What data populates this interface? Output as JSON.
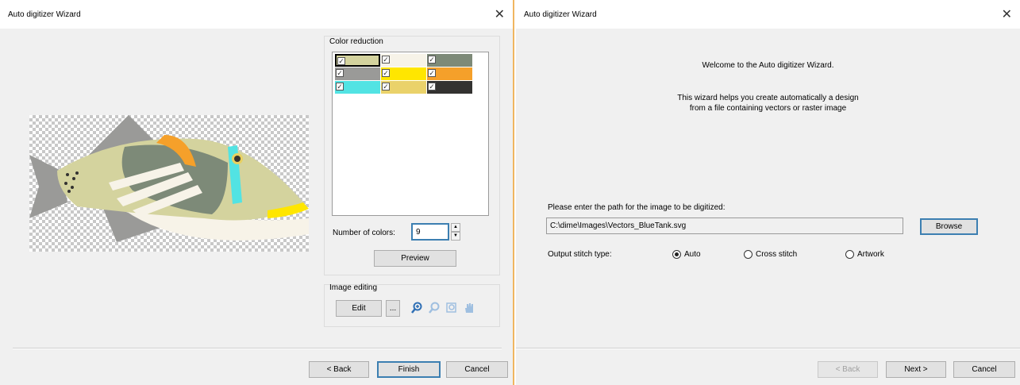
{
  "left_dialog": {
    "title": "Auto digitizer Wizard",
    "close_glyph": "✕",
    "color_reduction": {
      "label": "Color reduction",
      "swatches": [
        {
          "color": "#d4d39e",
          "checked": true,
          "selected": true
        },
        {
          "color": "#f7f3e8",
          "checked": true
        },
        {
          "color": "#7d8a78",
          "checked": true
        },
        {
          "color": "#9a9a98",
          "checked": true
        },
        {
          "color": "#ffe600",
          "checked": true
        },
        {
          "color": "#f5a02a",
          "checked": true
        },
        {
          "color": "#52e3e3",
          "checked": true
        },
        {
          "color": "#ead26a",
          "checked": true
        },
        {
          "color": "#333230",
          "checked": true
        }
      ],
      "number_of_colors_label": "Number of colors:",
      "number_of_colors_value": "9",
      "preview_label": "Preview"
    },
    "image_editing": {
      "label": "Image editing",
      "edit_label": "Edit",
      "more_label": "...",
      "tools": [
        "zoom-in-icon",
        "zoom-out-icon",
        "zoom-fit-icon",
        "pan-hand-icon"
      ]
    },
    "buttons": {
      "back": "< Back",
      "finish": "Finish",
      "cancel": "Cancel"
    }
  },
  "right_dialog": {
    "title": "Auto digitizer Wizard",
    "close_glyph": "✕",
    "welcome": "Welcome to the Auto digitizer Wizard.",
    "description_line1": "This wizard helps you create automatically a design",
    "description_line2": "from a file containing vectors or raster image",
    "path_label": "Please enter the path for the image to be digitized:",
    "path_value": "C:\\dime\\Images\\Vectors_BlueTank.svg",
    "browse_label": "Browse",
    "stitch_type_label": "Output stitch type:",
    "stitch_options": [
      {
        "label": "Auto",
        "selected": true
      },
      {
        "label": "Cross stitch",
        "selected": false
      },
      {
        "label": "Artwork",
        "selected": false
      }
    ],
    "buttons": {
      "back": "< Back",
      "next": "Next >",
      "cancel": "Cancel"
    }
  }
}
